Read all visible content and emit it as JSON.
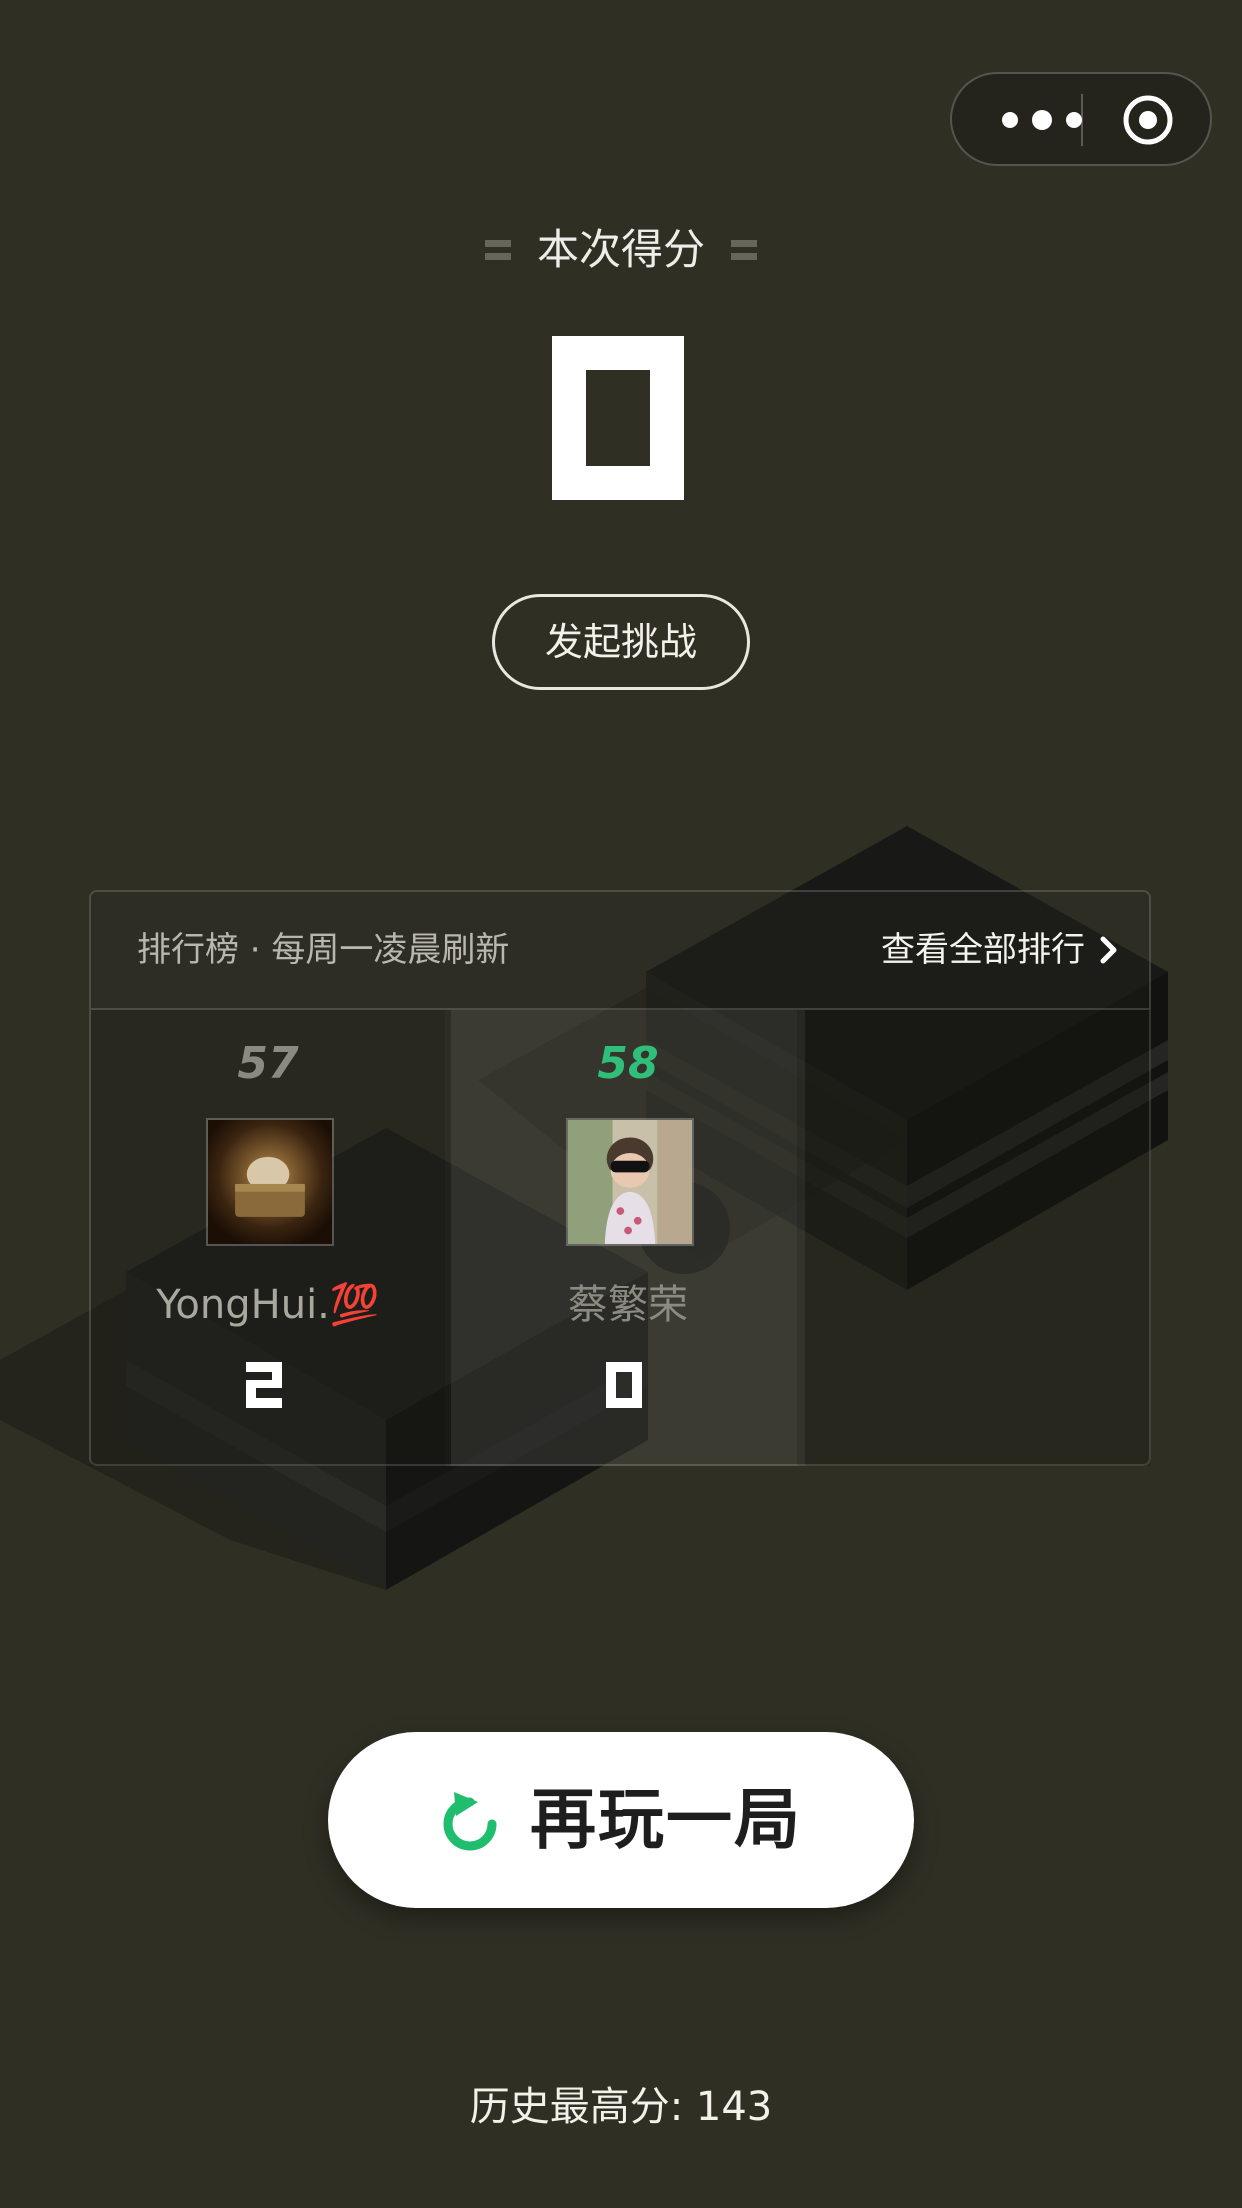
{
  "capsule": {
    "more_icon": "more-dots-icon",
    "close_icon": "target-circle-icon"
  },
  "score": {
    "title": "本次得分",
    "value": "0"
  },
  "challenge": {
    "label": "发起挑战"
  },
  "leaderboard": {
    "title": "排行榜 · 每周一凌晨刷新",
    "view_all": "查看全部排行",
    "players": [
      {
        "rank": "57",
        "name": "YongHui.💯",
        "score": "2",
        "rank_color": "#8a8a80",
        "name_color": "#a9a89f"
      },
      {
        "rank": "58",
        "name": "蔡繁荣",
        "score": "0",
        "rank_color": "#2fbf7a",
        "name_color": "#8c8b82"
      }
    ]
  },
  "replay": {
    "label": "再玩一局",
    "icon": "refresh-icon",
    "icon_color": "#1fbe6e"
  },
  "best_score": {
    "text": "历史最高分: 143"
  }
}
